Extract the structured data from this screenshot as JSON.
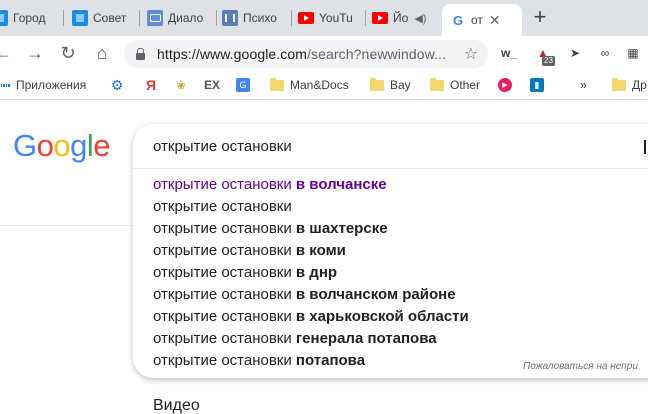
{
  "tabs": [
    {
      "title": "Город",
      "icon": "blue-square-icon"
    },
    {
      "title": "Совет",
      "icon": "blue-square-icon"
    },
    {
      "title": "Диало",
      "icon": "chat-icon"
    },
    {
      "title": "Психо",
      "icon": "pause-icon"
    },
    {
      "title": "YouTu",
      "icon": "youtube-icon"
    },
    {
      "title": "Йо",
      "icon": "youtube-icon"
    },
    {
      "title": "от",
      "icon": "google-icon"
    }
  ],
  "omnibox": {
    "url_host": "https://www.google.com",
    "url_rest": "/search?newwindow..."
  },
  "extensions": [
    "w_",
    "23"
  ],
  "bookmarks": [
    {
      "label": "Приложения",
      "icon": "apps-icon"
    },
    {
      "label": "",
      "icon": "gear-icon"
    },
    {
      "label": "",
      "icon": "yandex-icon"
    },
    {
      "label": "",
      "icon": "bird-icon"
    },
    {
      "label": "EX",
      "icon": ""
    },
    {
      "label": "",
      "icon": "translate-icon"
    },
    {
      "label": "Man&Docs",
      "icon": "folder-icon"
    },
    {
      "label": "Bay",
      "icon": "folder-icon"
    },
    {
      "label": "Other",
      "icon": "folder-icon"
    },
    {
      "label": "",
      "icon": "record-icon"
    },
    {
      "label": "",
      "icon": "trello-icon"
    },
    {
      "label": "»",
      "icon": ""
    },
    {
      "label": "Др",
      "icon": "folder-icon"
    }
  ],
  "logo_letters": [
    "G",
    "o",
    "o",
    "g",
    "l",
    "e"
  ],
  "search": {
    "query": "открытие остановки",
    "suggestions": [
      {
        "base": "открытие остановки ",
        "bold": "в волчанске",
        "visited": true
      },
      {
        "base": "открытие остановки",
        "bold": "",
        "visited": false
      },
      {
        "base": "открытие остановки ",
        "bold": "в шахтерске",
        "visited": false
      },
      {
        "base": "открытие остановки ",
        "bold": "в коми",
        "visited": false
      },
      {
        "base": "открытие остановки ",
        "bold": "в днр",
        "visited": false
      },
      {
        "base": "открытие остановки ",
        "bold": "в волчанском районе",
        "visited": false
      },
      {
        "base": "открытие остановки ",
        "bold": "в харьковской области",
        "visited": false
      },
      {
        "base": "открытие остановки ",
        "bold": "генерала потапова",
        "visited": false
      },
      {
        "base": "открытие остановки ",
        "bold": "потапова",
        "visited": false
      }
    ],
    "report_text": "Пожаловаться на непри"
  },
  "results_tab": "Видео"
}
